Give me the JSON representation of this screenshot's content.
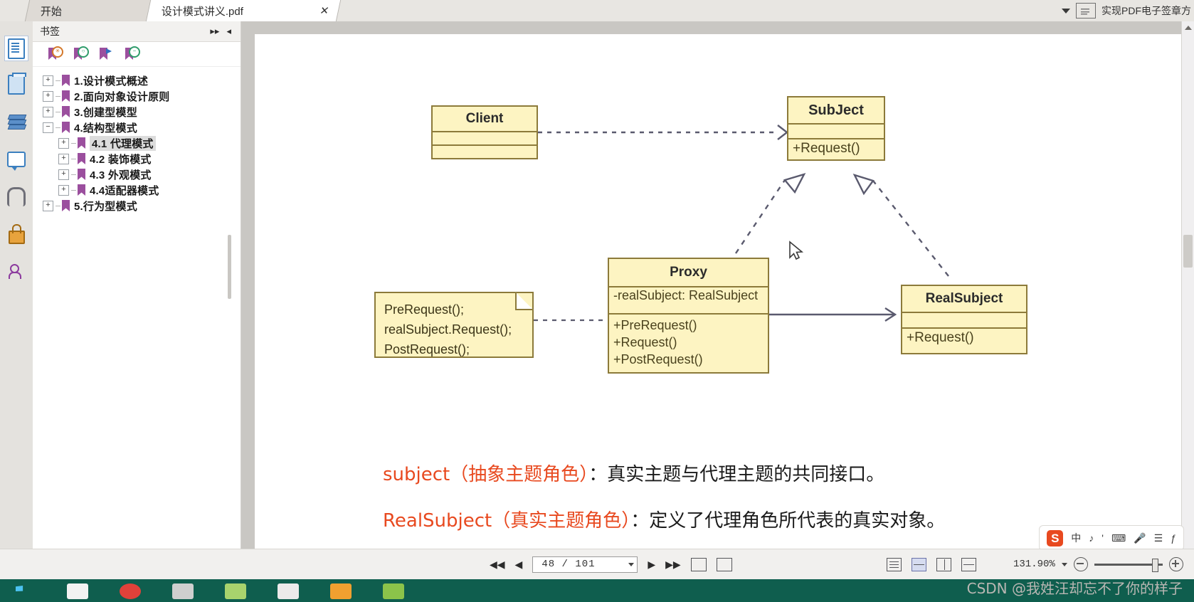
{
  "window": {
    "tabs": [
      {
        "label": "开始",
        "active": false,
        "closable": false
      },
      {
        "label": "设计模式讲义.pdf",
        "active": true,
        "closable": true,
        "close_glyph": "✕"
      }
    ],
    "right_toolbar": {
      "caret": "▼",
      "stamp_icon": "pdf-stamp-icon",
      "stamp_label": "实现PDF电子签章方"
    }
  },
  "rail": {
    "items": [
      {
        "name": "page-thumbnails",
        "icon": "page-icon",
        "selected": true
      },
      {
        "name": "page-organize",
        "icon": "pages-icon",
        "selected": false
      },
      {
        "name": "layers",
        "icon": "layers-icon",
        "selected": false
      },
      {
        "name": "comments",
        "icon": "comment-icon",
        "selected": false
      },
      {
        "name": "attachments",
        "icon": "paperclip-icon",
        "selected": false
      },
      {
        "name": "security",
        "icon": "lock-icon",
        "selected": false
      },
      {
        "name": "signatures",
        "icon": "signature-icon",
        "selected": false
      }
    ]
  },
  "bookmarks": {
    "header_title": "书签",
    "btn_expand": "▸▸",
    "btn_collapse": "◂",
    "toolbar_icons": [
      "bookmark-add-icon",
      "bookmark-goto-icon",
      "bookmark-next-icon",
      "bookmark-delete-icon"
    ],
    "tree": [
      {
        "label": "1.设计模式概述",
        "level": 0,
        "expander": "+",
        "selected": false
      },
      {
        "label": "2.面向对象设计原则",
        "level": 0,
        "expander": "+",
        "selected": false
      },
      {
        "label": "3.创建型模型",
        "level": 0,
        "expander": "+",
        "selected": false
      },
      {
        "label": "4.结构型模式",
        "level": 0,
        "expander": "−",
        "selected": false
      },
      {
        "label": "4.1 代理模式",
        "level": 1,
        "expander": "+",
        "selected": true
      },
      {
        "label": "4.2 装饰模式",
        "level": 1,
        "expander": "+",
        "selected": false
      },
      {
        "label": "4.3 外观模式",
        "level": 1,
        "expander": "+",
        "selected": false
      },
      {
        "label": "4.4适配器模式",
        "level": 1,
        "expander": "+",
        "selected": false
      },
      {
        "label": "5.行为型模式",
        "level": 0,
        "expander": "+",
        "selected": false
      }
    ]
  },
  "page_content": {
    "classes": [
      {
        "name": "Client",
        "title": "Client",
        "attributes": [
          ""
        ],
        "operations": [
          ""
        ]
      },
      {
        "name": "SubJect",
        "title": "SubJect",
        "attributes": [
          ""
        ],
        "operations": [
          "+Request()"
        ]
      },
      {
        "name": "Proxy",
        "title": "Proxy",
        "attributes": [
          "-realSubject: RealSubject"
        ],
        "operations": [
          "+PreRequest()",
          "+Request()",
          "+PostRequest()"
        ]
      },
      {
        "name": "RealSubject",
        "title": "RealSubject",
        "attributes": [
          ""
        ],
        "operations": [
          "+Request()"
        ]
      }
    ],
    "note": {
      "lines": [
        "PreRequest();",
        "realSubject.Request();",
        "PostRequest();"
      ]
    },
    "captions": [
      {
        "term": "subject（抽象主题角色）",
        "rest": "：真实主题与代理主题的共同接口。"
      },
      {
        "term": "RealSubject（真实主题角色）",
        "rest": "：定义了代理角色所代表的真实对象。"
      }
    ],
    "caption_color": "#e8491f"
  },
  "bottom_bar": {
    "first_page": "◀◀",
    "prev_page": "◀",
    "page_value": "48 / 101",
    "next_page": "▶",
    "last_page": "▶▶",
    "tools": [
      "page-snapshot-icon",
      "page-extract-icon"
    ],
    "view_modes": [
      {
        "name": "single-page",
        "selected": false
      },
      {
        "name": "continuous-page",
        "selected": true
      },
      {
        "name": "facing-page",
        "selected": false
      },
      {
        "name": "facing-continuous",
        "selected": false
      }
    ],
    "zoom_value": "131.90%",
    "zoom_caret": "▼",
    "zoom_out": "−",
    "zoom_in": "+"
  },
  "ime": {
    "logo": "S",
    "items": [
      "中",
      "♪",
      "'",
      "⌨",
      "🎤",
      "☰",
      "ƒ"
    ]
  },
  "watermark": "CSDN @我姓汪却忘不了你的样子",
  "colors": {
    "accent_red": "#e8491f",
    "uml_fill": "#fdf4c2",
    "uml_border": "#8c7a3a",
    "taskbar": "#0f5e4e",
    "bookmark_purple": "#9b4f9e"
  }
}
